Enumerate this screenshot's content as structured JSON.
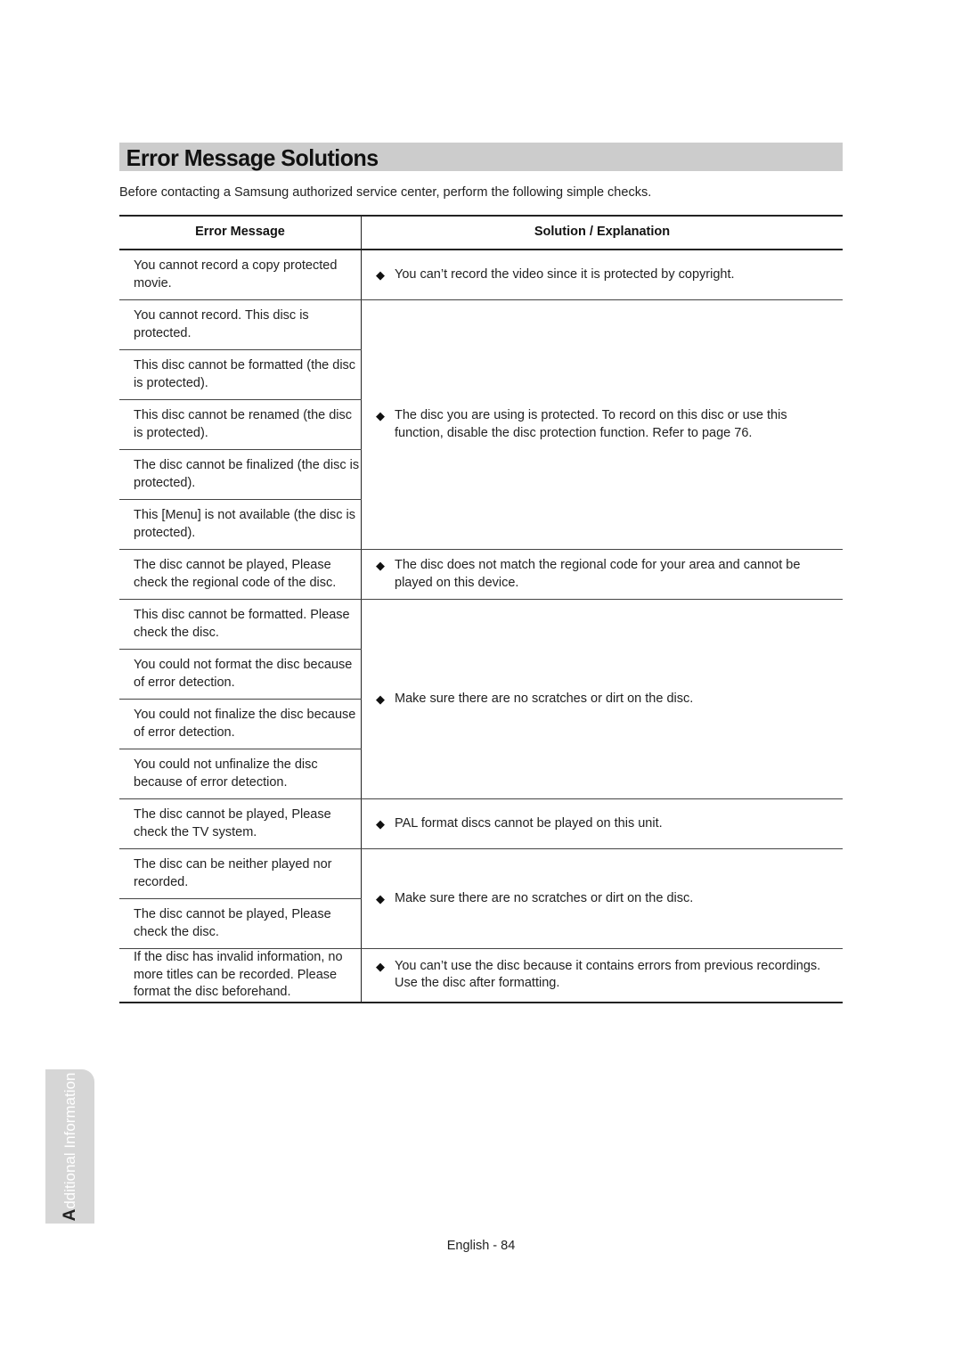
{
  "page": {
    "title": "Error Message Solutions",
    "intro": "Before contacting a Samsung authorized service center, perform the following simple checks.",
    "side_tab": {
      "first_letter": "A",
      "rest": "dditional Information"
    },
    "footer": "English - 84"
  },
  "table": {
    "headers": {
      "error": "Error Message",
      "solution": "Solution / Explanation"
    },
    "bullet_icon": "diamond-bullet",
    "groups": [
      {
        "messages": [
          "You cannot record a copy protected movie."
        ],
        "solution": "You can’t record the video since it is protected by copyright."
      },
      {
        "messages": [
          "You cannot record. This disc is protected.",
          "This disc cannot be formatted (the disc is protected).",
          "This disc cannot be renamed (the disc is protected).",
          "The disc cannot be finalized (the disc is protected).",
          "This [Menu] is not available (the disc is protected)."
        ],
        "solution": "The disc you are using is protected. To record on this disc or use this function, disable the disc protection function. Refer to page 76."
      },
      {
        "messages": [
          "The disc cannot be played, Please check the regional code of the disc."
        ],
        "solution": "The disc does not match the regional code for your area and cannot be played on this device."
      },
      {
        "messages": [
          "This disc cannot be formatted. Please check the disc.",
          "You could not format the disc because of error detection.",
          "You could not finalize the disc because of error detection.",
          "You could not unfinalize the disc because of error detection."
        ],
        "solution": "Make sure there are no scratches or dirt on the disc."
      },
      {
        "messages": [
          "The disc cannot be played, Please check the TV system."
        ],
        "solution": "PAL format discs cannot be played on this unit."
      },
      {
        "messages": [
          "The disc can be neither played nor recorded.",
          "The disc cannot be played, Please check the disc."
        ],
        "solution": "Make sure there are no scratches or dirt on the disc."
      },
      {
        "messages": [
          "If the disc has invalid information, no more titles can be recorded. Please format the disc beforehand."
        ],
        "solution": "You can’t use the disc because it contains errors from previous recordings. Use the disc after formatting."
      }
    ]
  }
}
